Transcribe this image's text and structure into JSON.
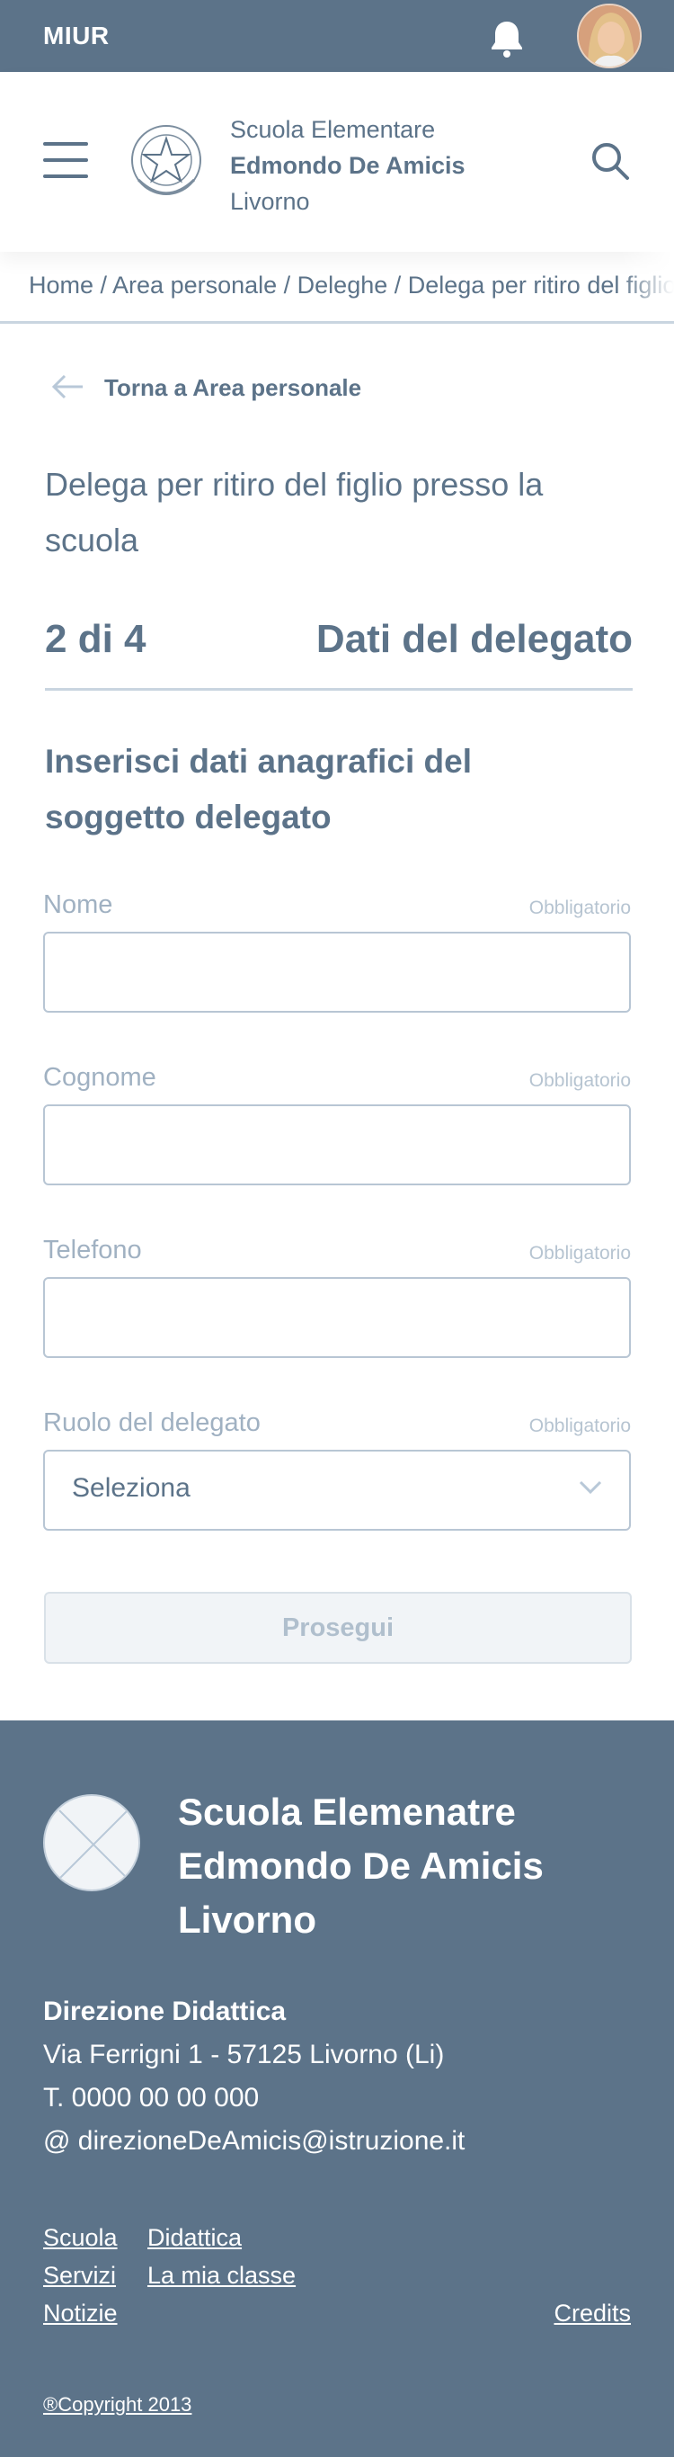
{
  "topbar": {
    "brand": "MIUR",
    "notifications_icon": "bell-icon",
    "avatar_icon": "user-avatar"
  },
  "header": {
    "menu_icon": "hamburger-icon",
    "emblem_icon": "italian-republic-emblem",
    "school_line1": "Scuola Elementare",
    "school_line2": "Edmondo De Amicis",
    "school_line3": "Livorno",
    "search_icon": "search-icon"
  },
  "breadcrumb": {
    "text": "Home / Area personale / Deleghe / Delega per ritiro del figlio presso la scuola"
  },
  "back": {
    "label": "Torna a Area personale",
    "icon": "arrow-left-icon"
  },
  "page": {
    "title": "Delega per ritiro del figlio presso la scuola",
    "step_number": "2 di 4",
    "step_title": "Dati del delegato",
    "subtitle": "Inserisci dati anagrafici del soggetto delegato"
  },
  "form": {
    "fields": [
      {
        "label": "Nome",
        "required": "Obbligatorio",
        "value": ""
      },
      {
        "label": "Cognome",
        "required": "Obbligatorio",
        "value": ""
      },
      {
        "label": "Telefono",
        "required": "Obbligatorio",
        "value": ""
      },
      {
        "label": "Ruolo del delegato",
        "required": "Obbligatorio",
        "value": "Seleziona"
      }
    ],
    "submit_label": "Prosegui"
  },
  "footer": {
    "school_line1": "Scuola Elemenatre",
    "school_line2": "Edmondo De Amicis",
    "school_line3": "Livorno",
    "direction": "Direzione Didattica",
    "address": "Via Ferrigni 1 - 57125 Livorno (Li)",
    "phone": "T. 0000 00 00 000",
    "email": "@ direzioneDeAmicis@istruzione.it",
    "links": [
      "Scuola",
      "Didattica",
      "Servizi",
      "La mia classe",
      "Notizie",
      "Credits"
    ],
    "copyright": "®Copyright 2013"
  },
  "colors": {
    "primary": "#5c7389",
    "border": "#c9d5e0",
    "muted": "#a0b1c2"
  }
}
